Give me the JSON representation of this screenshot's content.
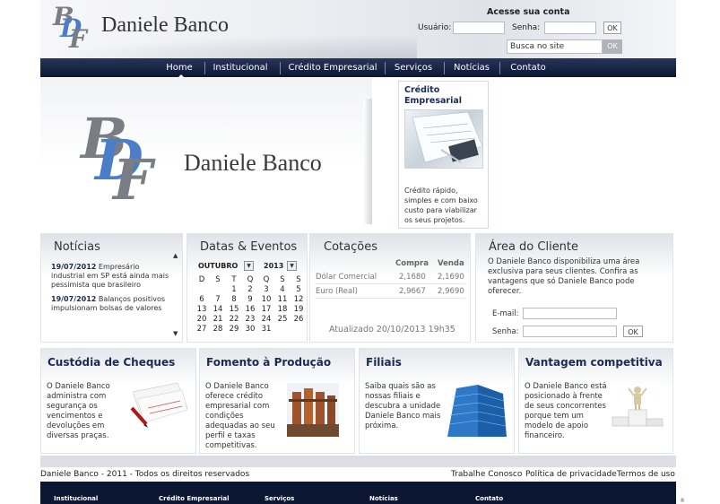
{
  "brand": {
    "name": "Daniele Banco",
    "logo_letters": [
      "B",
      "D",
      "F"
    ]
  },
  "login": {
    "title": "Acesse sua conta",
    "user_label": "Usuário:",
    "password_label": "Senha:",
    "ok_label": "OK",
    "search_value": "Busca no site",
    "search_ok": "OK"
  },
  "nav": {
    "items": [
      "Home",
      "Institucional",
      "Crédito Empresarial",
      "Serviços",
      "Notícias",
      "Contato"
    ]
  },
  "banner": {
    "title": "Daniele Banco"
  },
  "credit_box": {
    "title": "Crédito Empresarial",
    "description": "Crédito rápido, simples e com baixo custo para viabilizar os seus projetos."
  },
  "news": {
    "title": "Notícias",
    "items": [
      {
        "date": "19/07/2012",
        "text": "Empresário industrial em SP está ainda mais pessimista que brasileiro"
      },
      {
        "date": "19/07/2012",
        "text": "Balanços positivos impulsionam bolsas de valores"
      }
    ]
  },
  "events": {
    "title": "Datas & Eventos",
    "month": "OUTUBRO",
    "year": "2013",
    "weekdays": [
      "D",
      "S",
      "T",
      "Q",
      "Q",
      "S",
      "S"
    ],
    "weeks": [
      [
        "",
        "",
        "1",
        "2",
        "3",
        "4",
        "5"
      ],
      [
        "6",
        "7",
        "8",
        "9",
        "10",
        "11",
        "12"
      ],
      [
        "13",
        "14",
        "15",
        "16",
        "17",
        "18",
        "19"
      ],
      [
        "20",
        "21",
        "22",
        "23",
        "24",
        "25",
        "26"
      ],
      [
        "27",
        "28",
        "29",
        "30",
        "31",
        "",
        ""
      ]
    ]
  },
  "quotes": {
    "title": "Cotações",
    "headers": [
      "Compra",
      "Venda"
    ],
    "rows": [
      {
        "name": "Dólar Comercial",
        "buy": "2,1680",
        "sell": "2,1690"
      },
      {
        "name": "Euro (Real)",
        "buy": "2,9667",
        "sell": "2,9690"
      }
    ],
    "updated": "Atualizado 20/10/2013 19h35"
  },
  "client_area": {
    "title": "Área do Cliente",
    "text": "O Daniele Banco disponibiliza uma área exclusiva para seus clientes. Confira as vantagens que só Daniele Banco pode oferecer.",
    "email_label": "E-mail:",
    "password_label": "Senha:",
    "ok_label": "OK"
  },
  "services": [
    {
      "title": "Custódia de Cheques",
      "text": "O Daniele Banco administra com segurança os vencimentos e devoluções em diversas praças.",
      "image": "cheques-image"
    },
    {
      "title": "Fomento à Produção",
      "text": "O Daniele Banco oferece crédito empresarial com condições adequadas ao seu perfil e taxas competitivas.",
      "image": "factory-image"
    },
    {
      "title": "Filiais",
      "text": "Saiba quais são as nossas filiais e descubra a unidade Daniele Banco mais próxima.",
      "image": "building-image"
    },
    {
      "title": "Vantagem competitiva",
      "text": "O Daniele Banco está posicionado à frente de seus concorrentes porque tem um modelo de apoio financeiro.",
      "image": "podium-image"
    }
  ],
  "footer": {
    "copyright": "Daniele Banco - 2011 - Todos os direitos reservados",
    "links": [
      "Trabalhe Conosco",
      "Política de privacidade",
      "Termos de uso"
    ],
    "nav": [
      "Institucional",
      "Crédito Empresarial",
      "Serviços",
      "Notícias",
      "Contato"
    ],
    "badge": "®"
  },
  "colors": {
    "navy": "#0c1733",
    "accent_blue": "#4a7fc8",
    "logo_gray": "#7a7d83"
  }
}
